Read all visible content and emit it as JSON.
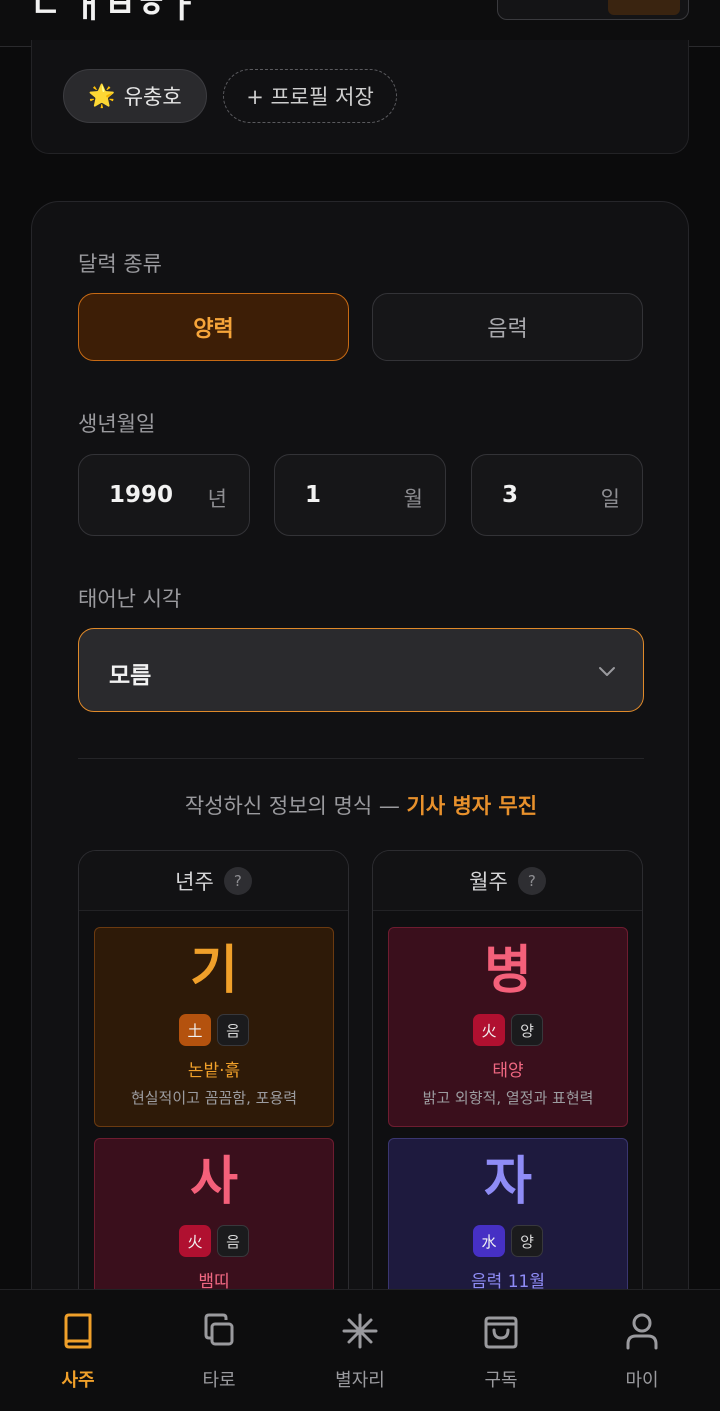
{
  "header": {
    "title_partial": "ㄷ ㅐㅂㅎㅏ"
  },
  "profile": {
    "saved_profile": {
      "icon": "star-icon",
      "name": "유충호"
    },
    "save_button_label": "+ 프로필 저장"
  },
  "calendar": {
    "label": "달력 종류",
    "options": [
      "양력",
      "음력"
    ],
    "selected": "양력"
  },
  "birthdate": {
    "label": "생년월일",
    "year": {
      "value": "1990",
      "unit": "년"
    },
    "month": {
      "value": "1",
      "unit": "월"
    },
    "day": {
      "value": "3",
      "unit": "일"
    }
  },
  "birthtime": {
    "label": "태어난 시각",
    "value": "모름"
  },
  "summary": {
    "prefix": "작성하신 정보의 명식 —",
    "name": "기사 병자 무진"
  },
  "pillars": [
    {
      "header": "년주",
      "help": "?",
      "stem": {
        "char": "기",
        "element": "土",
        "yinyang": "음",
        "meaning": "논밭·흙",
        "desc": "현실적이고 꼼꼼함, 포용력"
      },
      "branch": {
        "char": "사",
        "element": "火",
        "yinyang": "음",
        "meaning": "뱀띠"
      }
    },
    {
      "header": "월주",
      "help": "?",
      "stem": {
        "char": "병",
        "element": "火",
        "yinyang": "양",
        "meaning": "태양",
        "desc": "밝고 외향적, 열정과 표현력"
      },
      "branch": {
        "char": "자",
        "element": "水",
        "yinyang": "양",
        "meaning": "음력 11월"
      }
    }
  ],
  "nav": {
    "items": [
      {
        "label": "사주",
        "icon": "book-icon"
      },
      {
        "label": "타로",
        "icon": "cards-icon"
      },
      {
        "label": "별자리",
        "icon": "asterisk-icon"
      },
      {
        "label": "구독",
        "icon": "shopping-bag-icon"
      },
      {
        "label": "마이",
        "icon": "user-icon"
      }
    ],
    "active": "사주"
  },
  "colors": {
    "accent": "#f0a02a",
    "earth": "#b4520e",
    "fire": "#b01030",
    "water": "#4630c4"
  }
}
